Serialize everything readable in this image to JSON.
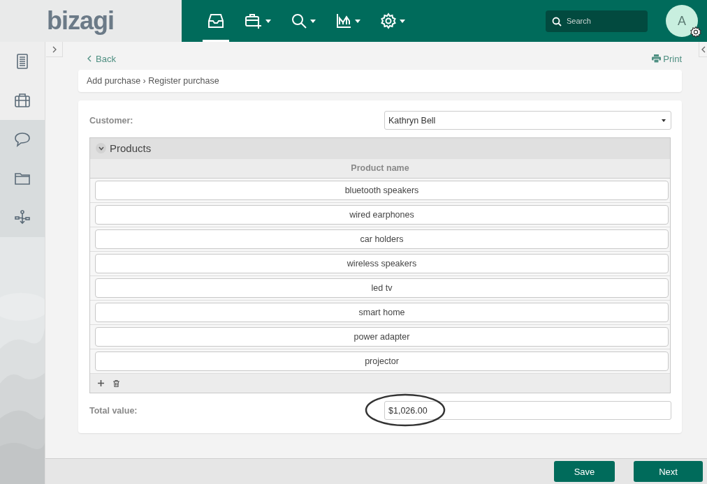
{
  "logo": {
    "text": "bizagi"
  },
  "nav": [
    {
      "kind": "inbox",
      "selected": true,
      "caret": false
    },
    {
      "kind": "new-case",
      "selected": false,
      "caret": true
    },
    {
      "kind": "search",
      "selected": false,
      "caret": true
    },
    {
      "kind": "chart",
      "selected": false,
      "caret": true
    },
    {
      "kind": "settings",
      "selected": false,
      "caret": true
    }
  ],
  "search": {
    "placeholder": "Search"
  },
  "avatar": {
    "initial": "A"
  },
  "sidebar": {
    "items": [
      {
        "kind": "list",
        "selected": true
      },
      {
        "kind": "briefcase",
        "selected": true
      },
      {
        "kind": "chat",
        "selected": false
      },
      {
        "kind": "folder",
        "selected": false
      },
      {
        "kind": "process",
        "selected": false
      }
    ]
  },
  "back": "Back",
  "print": "Print",
  "breadcrumb": "Add purchase › Register purchase",
  "form": {
    "customer": {
      "label": "Customer:",
      "value": "Kathryn Bell"
    },
    "products": {
      "title": "Products",
      "expanded": true,
      "column": "Product name",
      "rows": [
        "bluetooth speakers",
        "wired earphones",
        "car holders",
        "wireless speakers",
        "led tv",
        "smart home",
        "power adapter",
        "projector"
      ]
    },
    "total": {
      "label": "Total value:",
      "value": "$1,026.00",
      "highlighted": true
    }
  },
  "buttons": [
    {
      "label": "Save"
    },
    {
      "label": "Next"
    }
  ]
}
